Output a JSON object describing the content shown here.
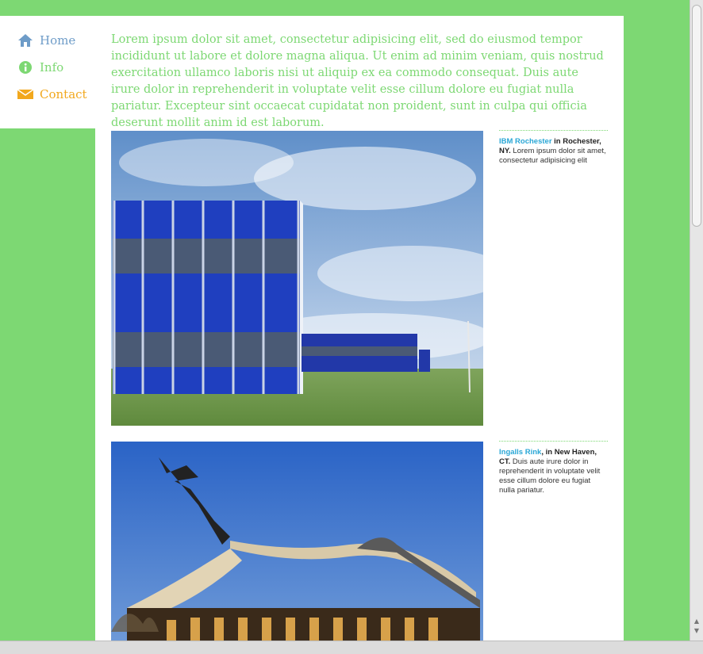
{
  "nav": {
    "items": [
      {
        "label": "Home",
        "icon": "home-icon",
        "color": "#6e9cc8"
      },
      {
        "label": "Info",
        "icon": "info-icon",
        "color": "#7dd873"
      },
      {
        "label": "Contact",
        "icon": "mail-icon",
        "color": "#f2a81d"
      }
    ]
  },
  "intro": {
    "text": "Lorem ipsum dolor sit amet, consectetur adipisicing elit, sed do eiusmod tempor incididunt ut labore et dolore magna aliqua. Ut enim ad minim veniam, quis nostrud exercitation ullamco laboris nisi ut aliquip ex ea commodo consequat. Duis aute irure dolor in reprehenderit in voluptate velit esse cillum dolore eu fugiat nulla pariatur. Excepteur sint occaecat cupidatat non proident, sunt in culpa qui officia deserunt mollit anim id est laborum."
  },
  "entries": [
    {
      "link": "IBM Rochester",
      "location": " in Rochester, NY.",
      "text": " Lorem ipsum dolor sit amet, consectetur adipisicing elit"
    },
    {
      "link": "Ingalls Rink",
      "location": ", in New Haven, CT.",
      "text": " Duis aute irure dolor in reprehenderit in voluptate velit esse cillum dolore eu fugiat nulla pariatur."
    }
  ],
  "colors": {
    "background": "#7dd873",
    "link": "#2aa7d6",
    "home": "#6e9cc8",
    "contact": "#f2a81d"
  }
}
